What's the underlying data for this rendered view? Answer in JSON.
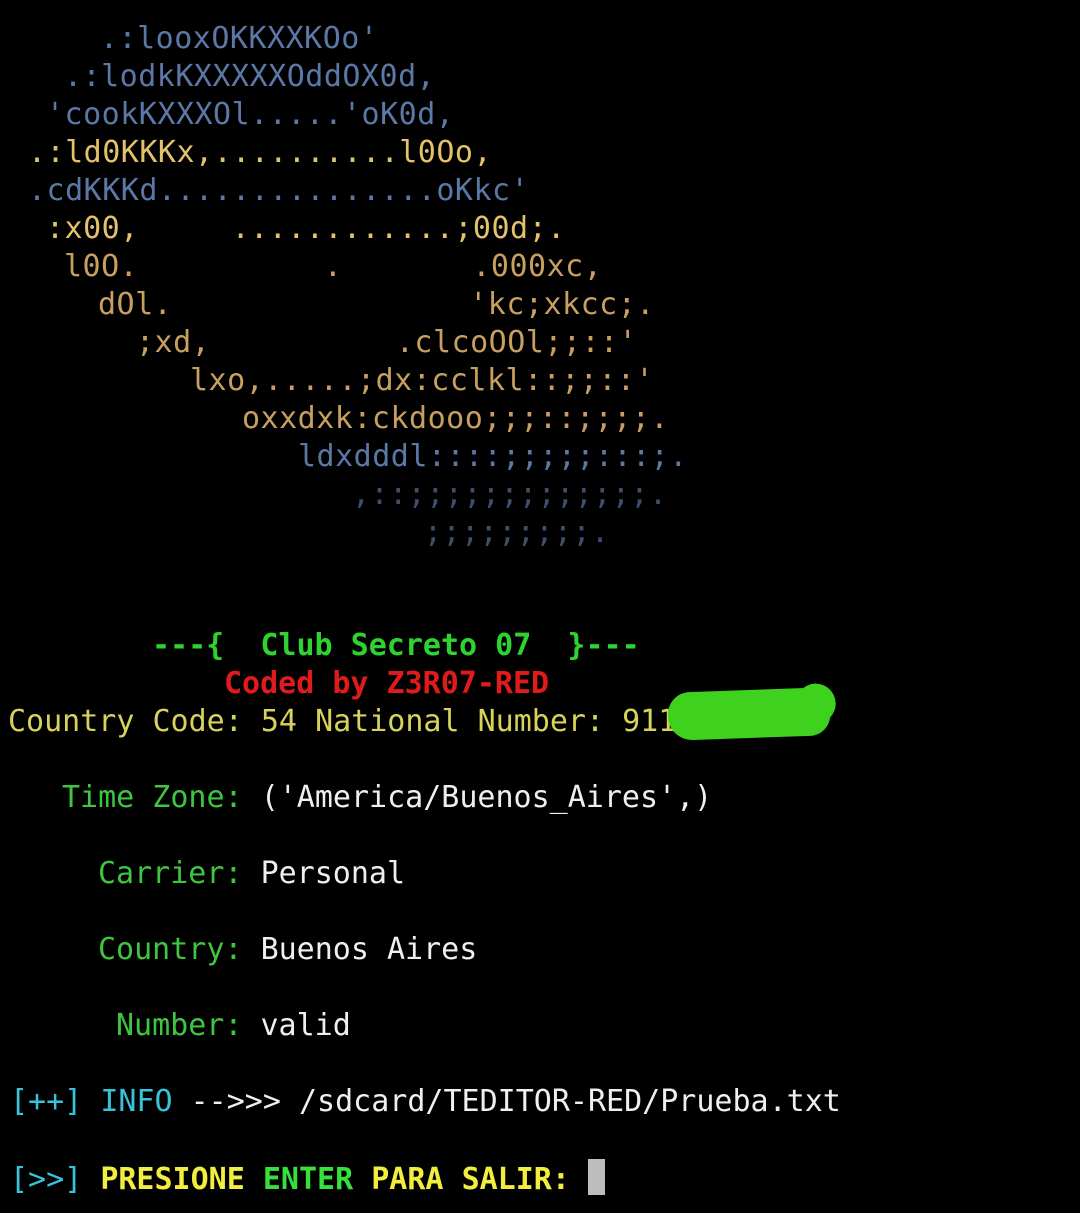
{
  "ascii_art": [
    ".:looxOKKXXKOo'",
    ".:lodkKXXXXXOddOX0d,",
    "'cookKXXXOl.....'oK0d,",
    ".:ld0KKKx,..........l0Oo,",
    ".cdKKKd...............oKkc'",
    ":x00,     ............;00d;.",
    "l0O.          .       .000xc,",
    "dOl.                'kc;xkcc;.",
    ";xd,          .clcoOOl;;::'",
    "lxo,.....;dx:cclkl::;;::'",
    "oxxdxk:ckdooo;;;::;;;;.",
    "ldxdddl::::;;;;;:::;.",
    ",::;;;;;;;;;;;;;.",
    ";;;;;;;;;."
  ],
  "banner": {
    "title": "---{  Club Secreto 07  }---",
    "coded_by": "Coded by Z3R07-RED"
  },
  "info": {
    "country_code_label": "Country Code:",
    "country_code": "54",
    "national_number_label": "National Number:",
    "national_number_visible": "911",
    "time_zone_label": "Time Zone:",
    "time_zone": "('America/Buenos_Aires',)",
    "carrier_label": "Carrier:",
    "carrier": "Personal",
    "country_label": "Country:",
    "country": "Buenos Aires",
    "number_label": "Number:",
    "number": "valid"
  },
  "output": {
    "info_prefix": "[++]",
    "info_word": "INFO",
    "arrow": "-->>>",
    "path": "/sdcard/TEDITOR-RED/Prueba.txt",
    "prompt_prefix": "[>>]",
    "prompt_w1": "PRESIONE",
    "prompt_w2": "ENTER",
    "prompt_w3": "PARA",
    "prompt_w4": "SALIR:"
  },
  "colors": {
    "background": "#000000",
    "label_green": "#3fc53f",
    "banner_red": "#e11b1b",
    "cyan": "#37c3d9",
    "yellow": "#f2ee3f"
  }
}
